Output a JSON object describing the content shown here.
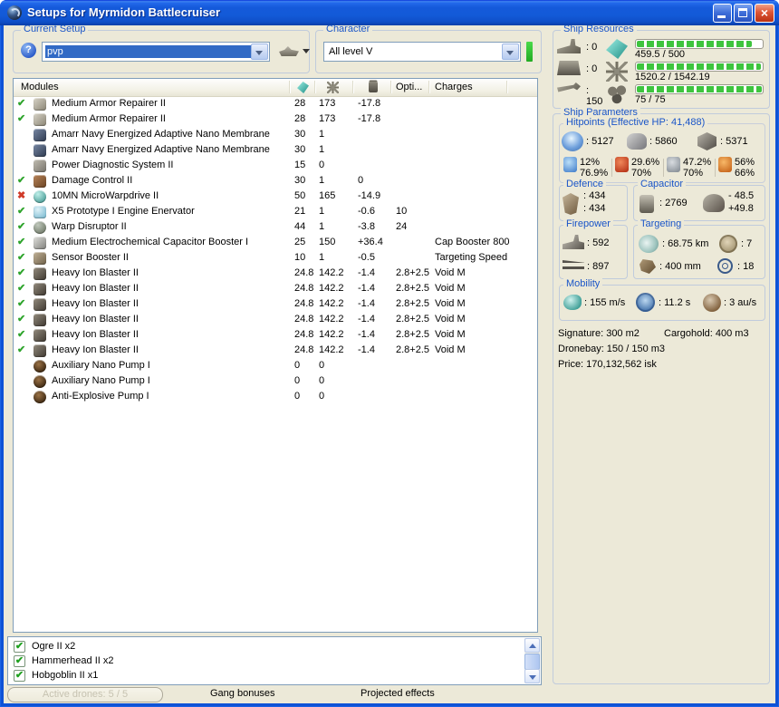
{
  "window": {
    "title": "Setups for Myrmidon Battlecruiser"
  },
  "current_setup": {
    "label": "Current Setup",
    "value": "pvp"
  },
  "character": {
    "label": "Character",
    "value": "All level V"
  },
  "ship_resources": {
    "label": "Ship Resources",
    "hardpoints": [
      {
        "icon": "ri-turret",
        "name": "turret-hardpoints-icon",
        "value": ": 0"
      },
      {
        "icon": "ri-launcher",
        "name": "launcher-hardpoints-icon",
        "value": ": 0"
      },
      {
        "icon": "ri-calibration",
        "name": "calibration-icon",
        "value": ": 150"
      }
    ],
    "bars": [
      {
        "icon": "ic-cpu-big",
        "name": "cpu-icon",
        "label": "459.5 / 500",
        "fill": 92
      },
      {
        "icon": "ic-pg-big",
        "name": "powergrid-icon",
        "label": "1520.2 / 1542.19",
        "fill": 99
      },
      {
        "icon": "ic-drone-big",
        "name": "drone-bandwidth-icon",
        "label": "75 / 75",
        "fill": 100
      }
    ]
  },
  "modules": {
    "header": {
      "name": "Modules",
      "opti": "Opti...",
      "charges": "Charges"
    },
    "rows": [
      {
        "status": "ok",
        "icon": "armor-repairer",
        "name": "Medium Armor Repairer II",
        "cpu": "28",
        "pg": "173",
        "cap": "-17.8",
        "opti": "",
        "charge": ""
      },
      {
        "status": "ok",
        "icon": "armor-repairer",
        "name": "Medium Armor Repairer II",
        "cpu": "28",
        "pg": "173",
        "cap": "-17.8",
        "opti": "",
        "charge": ""
      },
      {
        "status": "none",
        "icon": "nano-membrane",
        "name": "Amarr Navy Energized Adaptive Nano Membrane",
        "cpu": "30",
        "pg": "1",
        "cap": "",
        "opti": "",
        "charge": ""
      },
      {
        "status": "none",
        "icon": "nano-membrane",
        "name": "Amarr Navy Energized Adaptive Nano Membrane",
        "cpu": "30",
        "pg": "1",
        "cap": "",
        "opti": "",
        "charge": ""
      },
      {
        "status": "none",
        "icon": "power-diagnostic",
        "name": "Power Diagnostic System II",
        "cpu": "15",
        "pg": "0",
        "cap": "",
        "opti": "",
        "charge": ""
      },
      {
        "status": "ok",
        "icon": "damage-control",
        "name": "Damage Control II",
        "cpu": "30",
        "pg": "1",
        "cap": "0",
        "opti": "",
        "charge": ""
      },
      {
        "status": "off",
        "icon": "microwarpdrive",
        "name": "10MN MicroWarpdrive II",
        "cpu": "50",
        "pg": "165",
        "cap": "-14.9",
        "opti": "",
        "charge": ""
      },
      {
        "status": "ok",
        "icon": "stasis-enervator",
        "name": "X5 Prototype I Engine Enervator",
        "cpu": "21",
        "pg": "1",
        "cap": "-0.6",
        "opti": "10",
        "charge": ""
      },
      {
        "status": "ok",
        "icon": "warp-disruptor",
        "name": "Warp Disruptor II",
        "cpu": "44",
        "pg": "1",
        "cap": "-3.8",
        "opti": "24",
        "charge": ""
      },
      {
        "status": "ok",
        "icon": "cap-booster",
        "name": "Medium Electrochemical Capacitor Booster I",
        "cpu": "25",
        "pg": "150",
        "cap": "+36.4",
        "opti": "",
        "charge": "Cap Booster 800"
      },
      {
        "status": "ok",
        "icon": "sensor-booster",
        "name": "Sensor Booster II",
        "cpu": "10",
        "pg": "1",
        "cap": "-0.5",
        "opti": "",
        "charge": "Targeting Speed"
      },
      {
        "status": "ok",
        "icon": "blaster",
        "name": "Heavy Ion Blaster II",
        "cpu": "24.8",
        "pg": "142.2",
        "cap": "-1.4",
        "opti": "2.8+2.5",
        "charge": "Void M"
      },
      {
        "status": "ok",
        "icon": "blaster",
        "name": "Heavy Ion Blaster II",
        "cpu": "24.8",
        "pg": "142.2",
        "cap": "-1.4",
        "opti": "2.8+2.5",
        "charge": "Void M"
      },
      {
        "status": "ok",
        "icon": "blaster",
        "name": "Heavy Ion Blaster II",
        "cpu": "24.8",
        "pg": "142.2",
        "cap": "-1.4",
        "opti": "2.8+2.5",
        "charge": "Void M"
      },
      {
        "status": "ok",
        "icon": "blaster",
        "name": "Heavy Ion Blaster II",
        "cpu": "24.8",
        "pg": "142.2",
        "cap": "-1.4",
        "opti": "2.8+2.5",
        "charge": "Void M"
      },
      {
        "status": "ok",
        "icon": "blaster",
        "name": "Heavy Ion Blaster II",
        "cpu": "24.8",
        "pg": "142.2",
        "cap": "-1.4",
        "opti": "2.8+2.5",
        "charge": "Void M"
      },
      {
        "status": "ok",
        "icon": "blaster",
        "name": "Heavy Ion Blaster II",
        "cpu": "24.8",
        "pg": "142.2",
        "cap": "-1.4",
        "opti": "2.8+2.5",
        "charge": "Void M"
      },
      {
        "status": "none",
        "icon": "nano-pump",
        "name": "Auxiliary Nano Pump I",
        "cpu": "0",
        "pg": "0",
        "cap": "",
        "opti": "",
        "charge": ""
      },
      {
        "status": "none",
        "icon": "nano-pump",
        "name": "Auxiliary Nano Pump I",
        "cpu": "0",
        "pg": "0",
        "cap": "",
        "opti": "",
        "charge": ""
      },
      {
        "status": "none",
        "icon": "anti-explosive-pump",
        "name": "Anti-Explosive Pump I",
        "cpu": "0",
        "pg": "0",
        "cap": "",
        "opti": "",
        "charge": ""
      }
    ]
  },
  "ship_parameters": {
    "label": "Ship Parameters",
    "hitpoints": {
      "label": "Hitpoints (Effective HP: 41,488)",
      "shield": ": 5127",
      "armor": ": 5860",
      "structure": ": 5371",
      "resists": [
        {
          "icon": "ri-em",
          "name": "em-resist-icon",
          "top": "12%",
          "bottom": "76.9%"
        },
        {
          "icon": "ri-thermal",
          "name": "thermal-resist-icon",
          "top": "29.6%",
          "bottom": "70%"
        },
        {
          "icon": "ri-kinetic",
          "name": "kinetic-resist-icon",
          "top": "47.2%",
          "bottom": "70%"
        },
        {
          "icon": "ri-explosive",
          "name": "explosive-resist-icon",
          "top": "56%",
          "bottom": "66%"
        }
      ]
    },
    "defence": {
      "label": "Defence",
      "line1": ": 434",
      "line2": ": 434"
    },
    "capacitor": {
      "label": "Capacitor",
      "amount": ": 2769",
      "delta_top": "- 48.5",
      "delta_bottom": "+49.8"
    },
    "firepower": {
      "label": "Firepower",
      "volley": ": 592",
      "dps": ": 897"
    },
    "targeting": {
      "label": "Targeting",
      "range": ": 68.75 km",
      "sensor": ": 7",
      "resolution": ": 400 mm",
      "targets": ": 18"
    },
    "mobility": {
      "label": "Mobility",
      "speed": ": 155 m/s",
      "align": ": 11.2 s",
      "warp": ": 3 au/s"
    },
    "stats": {
      "signature": "Signature: 300 m2",
      "cargohold": "Cargohold: 400 m3",
      "dronebay": "Dronebay: 150 / 150 m3",
      "price": "Price: 170,132,562 isk"
    }
  },
  "drones": {
    "items": [
      {
        "checked": true,
        "label": "Ogre II x2"
      },
      {
        "checked": true,
        "label": "Hammerhead II x2"
      },
      {
        "checked": true,
        "label": "Hobgoblin II x1"
      }
    ]
  },
  "footer": {
    "active_drones": "Active drones: 5 / 5",
    "gang_bonuses": "Gang bonuses",
    "projected_effects": "Projected effects"
  },
  "colors": {
    "titlebar_blue": "#1459DA",
    "client_beige": "#ECE9D8",
    "selection_blue": "#316AC5",
    "caption_blue": "#1A55C8",
    "bar_green": "#3EC43E",
    "status_ok_green": "#2EA42C",
    "status_off_red": "#D03A28",
    "close_red": "#DD5535"
  }
}
